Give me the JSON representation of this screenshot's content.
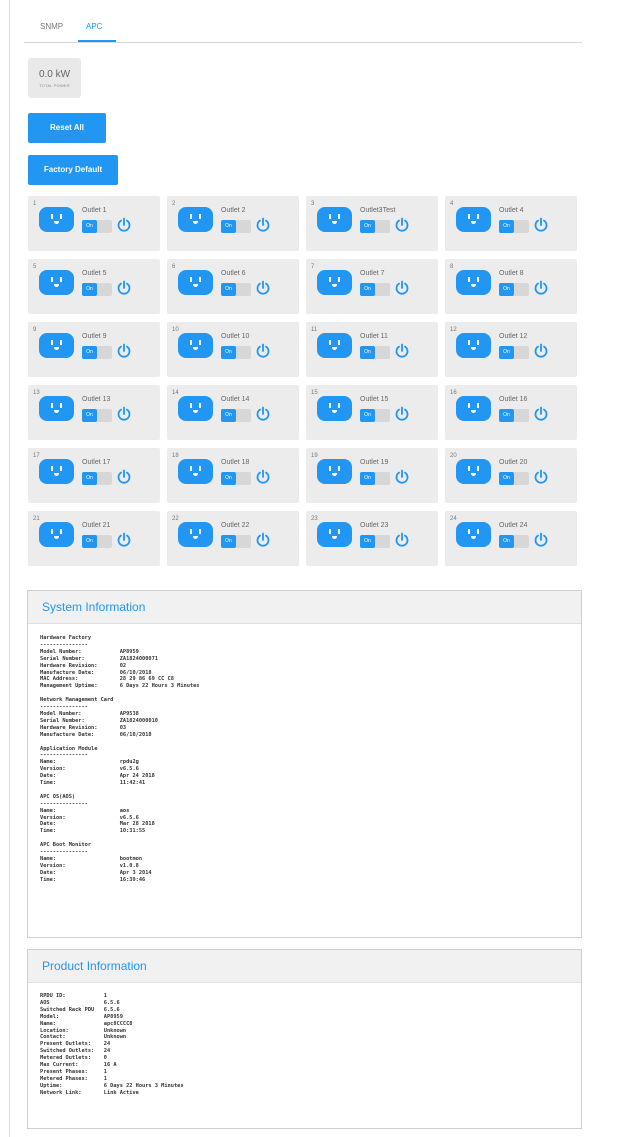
{
  "tabs": [
    {
      "label": "SNMP"
    },
    {
      "label": "APC"
    }
  ],
  "power": {
    "value": "0.0 kW",
    "label": "TOTAL POWER"
  },
  "buttons": {
    "reset": "Reset All",
    "factory": "Factory Default"
  },
  "colors": {
    "accent": "#2196f3",
    "card": "#ececec"
  },
  "icons": {
    "outlet": "outlet-plug-icon",
    "power": "power-icon"
  },
  "outlets": [
    {
      "num": "1",
      "name": "Outlet 1",
      "state": "On"
    },
    {
      "num": "2",
      "name": "Outlet 2",
      "state": "On"
    },
    {
      "num": "3",
      "name": "Outlet3Test",
      "state": "On"
    },
    {
      "num": "4",
      "name": "Outlet 4",
      "state": "On"
    },
    {
      "num": "5",
      "name": "Outlet 5",
      "state": "On"
    },
    {
      "num": "6",
      "name": "Outlet 6",
      "state": "On"
    },
    {
      "num": "7",
      "name": "Outlet 7",
      "state": "On"
    },
    {
      "num": "8",
      "name": "Outlet 8",
      "state": "On"
    },
    {
      "num": "9",
      "name": "Outlet 9",
      "state": "On"
    },
    {
      "num": "10",
      "name": "Outlet 10",
      "state": "On"
    },
    {
      "num": "11",
      "name": "Outlet 11",
      "state": "On"
    },
    {
      "num": "12",
      "name": "Outlet 12",
      "state": "On"
    },
    {
      "num": "13",
      "name": "Outlet 13",
      "state": "On"
    },
    {
      "num": "14",
      "name": "Outlet 14",
      "state": "On"
    },
    {
      "num": "15",
      "name": "Outlet 15",
      "state": "On"
    },
    {
      "num": "16",
      "name": "Outlet 16",
      "state": "On"
    },
    {
      "num": "17",
      "name": "Outlet 17",
      "state": "On"
    },
    {
      "num": "18",
      "name": "Outlet 18",
      "state": "On"
    },
    {
      "num": "19",
      "name": "Outlet 19",
      "state": "On"
    },
    {
      "num": "20",
      "name": "Outlet 20",
      "state": "On"
    },
    {
      "num": "21",
      "name": "Outlet 21",
      "state": "On"
    },
    {
      "num": "22",
      "name": "Outlet 22",
      "state": "On"
    },
    {
      "num": "23",
      "name": "Outlet 23",
      "state": "On"
    },
    {
      "num": "24",
      "name": "Outlet 24",
      "state": "On"
    }
  ],
  "system_info": {
    "title": "System Information",
    "text": "Hardware Factory\n---------------\nModel Number:            AP8959\nSerial Number:           ZA1824000071\nHardware Revision:       02\nManufacture Date:        06/10/2018\nMAC Address:             28 29 86 69 CC C8\nManagement Uptime:       6 Days 22 Hours 3 Minutes\n\nNetwork Management Card\n---------------\nModel Number:            AP9538\nSerial Number:           ZA1824000010\nHardware Revision:       03\nManufacture Date:        06/10/2018\n\nApplication Module\n---------------\nName:                    rpdu2g\nVersion:                 v6.5.6\nDate:                    Apr 24 2018\nTime:                    11:42:41\n\nAPC OS(AOS)\n---------------\nName:                    aos\nVersion:                 v6.5.6\nDate:                    Mar 28 2018\nTime:                    10:31:55\n\nAPC Boot Monitor\n---------------\nName:                    bootmon\nVersion:                 v1.0.8\nDate:                    Apr 3 2014\nTime:                    16:39:46"
  },
  "product_info": {
    "title": "Product Information",
    "text": "RPDU ID:            1\nAOS                 6.5.6\nSwitched Rack PDU   6.5.6\nModel:              AP8959\nName:               apc8CCCC8\nLocation:           Unknown\nContact:            Unknown\nPresent Outlets:    24\nSwitched Outlets:   24\nMetered Outlets:    0\nMax Current:        16 A\nPresent Phases:     1\nMetered Phases:     1\nUptime:             6 Days 22 Hours 3 Minutes\nNetwork Link:       Link Active"
  }
}
